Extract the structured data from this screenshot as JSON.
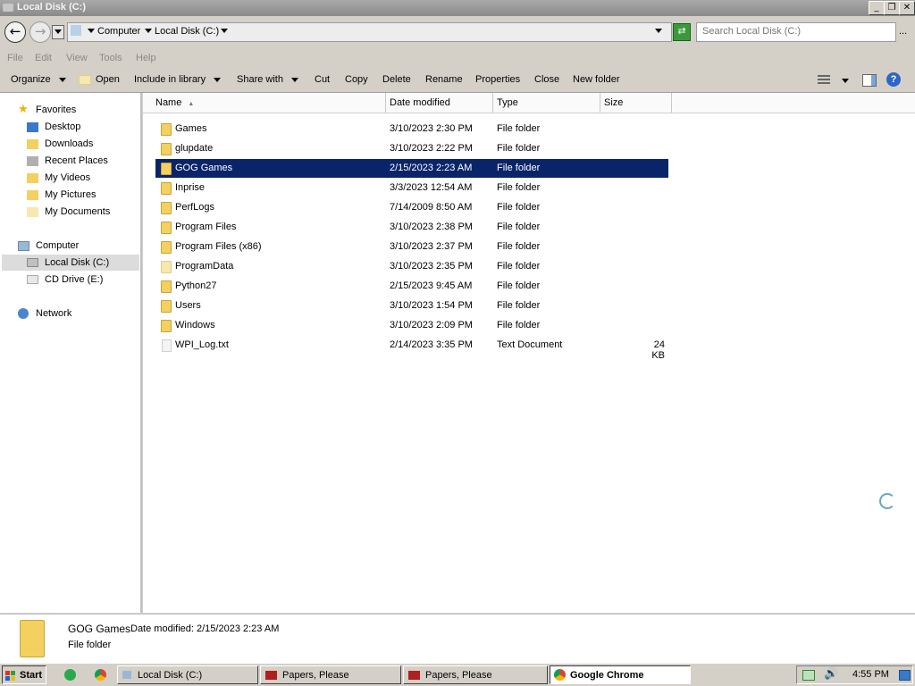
{
  "window": {
    "title": "Local Disk (C:)"
  },
  "address": {
    "crumbs": [
      "Computer",
      "Local Disk (C:)"
    ]
  },
  "search": {
    "placeholder": "Search Local Disk (C:)",
    "more": "..."
  },
  "menu": [
    "File",
    "Edit",
    "View",
    "Tools",
    "Help"
  ],
  "toolbar": {
    "organize": "Organize",
    "open": "Open",
    "include": "Include in library",
    "share": "Share with",
    "cut": "Cut",
    "copy": "Copy",
    "delete": "Delete",
    "rename": "Rename",
    "properties": "Properties",
    "close": "Close",
    "new_folder": "New folder"
  },
  "nav": {
    "favorites": "Favorites",
    "fav_items": [
      "Desktop",
      "Downloads",
      "Recent Places",
      "My Videos",
      "My Pictures",
      "My Documents"
    ],
    "computer": "Computer",
    "computer_items": [
      "Local Disk (C:)",
      "CD Drive (E:)"
    ],
    "network": "Network"
  },
  "columns": {
    "name": "Name",
    "date": "Date modified",
    "type": "Type",
    "size": "Size"
  },
  "files": [
    {
      "name": "Games",
      "date": "3/10/2023 2:30 PM",
      "type": "File folder",
      "size": ""
    },
    {
      "name": "glupdate",
      "date": "3/10/2023 2:22 PM",
      "type": "File folder",
      "size": ""
    },
    {
      "name": "GOG Games",
      "date": "2/15/2023 2:23 AM",
      "type": "File folder",
      "size": ""
    },
    {
      "name": "Inprise",
      "date": "3/3/2023 12:54 AM",
      "type": "File folder",
      "size": ""
    },
    {
      "name": "PerfLogs",
      "date": "7/14/2009 8:50 AM",
      "type": "File folder",
      "size": ""
    },
    {
      "name": "Program Files",
      "date": "3/10/2023 2:38 PM",
      "type": "File folder",
      "size": ""
    },
    {
      "name": "Program Files (x86)",
      "date": "3/10/2023 2:37 PM",
      "type": "File folder",
      "size": ""
    },
    {
      "name": "ProgramData",
      "date": "3/10/2023 2:35 PM",
      "type": "File folder",
      "size": ""
    },
    {
      "name": "Python27",
      "date": "2/15/2023 9:45 AM",
      "type": "File folder",
      "size": ""
    },
    {
      "name": "Users",
      "date": "3/10/2023 1:54 PM",
      "type": "File folder",
      "size": ""
    },
    {
      "name": "Windows",
      "date": "3/10/2023 2:09 PM",
      "type": "File folder",
      "size": ""
    },
    {
      "name": "WPI_Log.txt",
      "date": "2/14/2023 3:35 PM",
      "type": "Text Document",
      "size": "24 KB"
    }
  ],
  "details": {
    "name": "GOG Games",
    "date_label": "Date modified:",
    "date_value": "2/15/2023 2:23 AM",
    "type": "File folder"
  },
  "taskbar": {
    "start": "Start",
    "tasks": [
      "Local Disk (C:)",
      "Papers, Please",
      "Papers, Please",
      "Google Chrome"
    ],
    "clock": "4:55 PM"
  }
}
